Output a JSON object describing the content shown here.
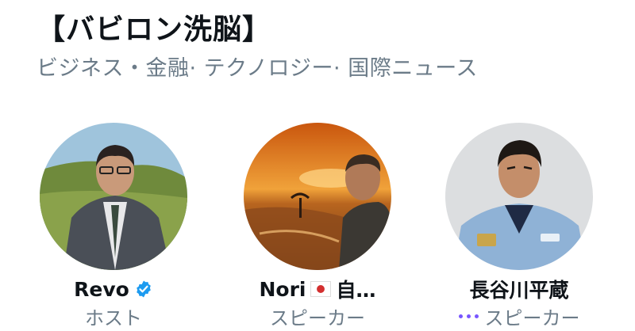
{
  "header": {
    "title": "【バビロン洗脳】",
    "subtitle": "ビジネス・金融· テクノロジー· 国際ニュース"
  },
  "speakers": [
    {
      "name": "Revo",
      "role": "ホスト",
      "verified": true
    },
    {
      "name": "Nori",
      "name_suffix": "自…",
      "role": "スピーカー",
      "flag": "japan-flag-icon"
    },
    {
      "name": "長谷川平蔵",
      "role": "スピーカー",
      "speaking": true
    }
  ],
  "colors": {
    "verified_badge": "#1d9bf0",
    "speaking_dots": "#7856ff",
    "secondary_text": "#6b7b88"
  }
}
